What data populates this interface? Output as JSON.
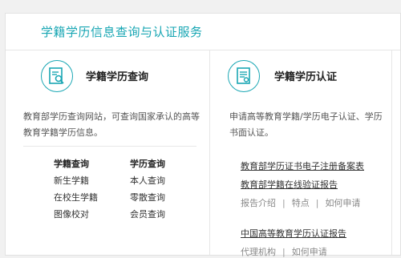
{
  "panel": {
    "title": "学籍学历信息查询与认证服务"
  },
  "query": {
    "title": "学籍学历查询",
    "desc": "教育部学历查询网站，可查询国家承认的高等教育学籍学历信息。",
    "col_heads": [
      "学籍查询",
      "学历查询"
    ],
    "links": [
      [
        "新生学籍",
        "本人查询"
      ],
      [
        "在校生学籍",
        "零散查询"
      ],
      [
        "图像校对",
        "会员查询"
      ]
    ]
  },
  "cert": {
    "title": "学籍学历认证",
    "desc": "申请高等教育学籍/学历电子认证、学历书面认证。",
    "link1": "教育部学历证书电子注册备案表",
    "link2": "教育部学籍在线验证报告",
    "sub1": [
      "报告介绍",
      "特点",
      "如何申请"
    ],
    "link3": "中国高等教育学历认证报告",
    "sub2": [
      "代理机构",
      "如何申请"
    ],
    "sep": "|"
  },
  "colors": {
    "accent": "#17a6b3"
  },
  "icons": [
    "search-document-icon",
    "certificate-document-icon"
  ]
}
